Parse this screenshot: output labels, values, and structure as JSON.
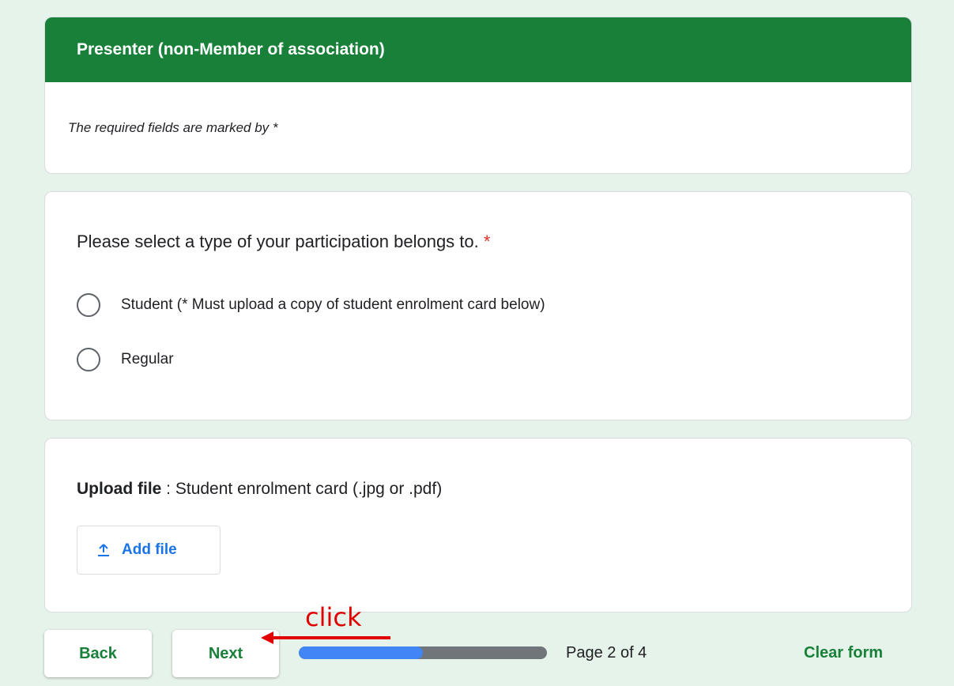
{
  "section": {
    "title": "Presenter (non-Member of association)",
    "description": "The required fields are marked by *"
  },
  "question": {
    "title": "Please select a type of your participation belongs to.",
    "required_mark": "*",
    "options": [
      {
        "label": "Student  (* Must upload a copy of student enrolment card below)"
      },
      {
        "label": "Regular"
      }
    ]
  },
  "upload": {
    "title_bold": "Upload file",
    "title_rest": " : Student enrolment card (.jpg or .pdf)",
    "button_label": "Add file",
    "button_icon": "upload-icon"
  },
  "footer": {
    "back_label": "Back",
    "next_label": "Next",
    "page_text": "Page 2 of 4",
    "progress_fraction": 0.5,
    "clear_label": "Clear form"
  },
  "annotation": {
    "text": "click",
    "color": "#e00000"
  },
  "colors": {
    "theme_green": "#188038",
    "background": "#e6f3ea",
    "link_blue": "#1a73e8",
    "progress_fill": "#4285f4",
    "required_red": "#d93025"
  }
}
